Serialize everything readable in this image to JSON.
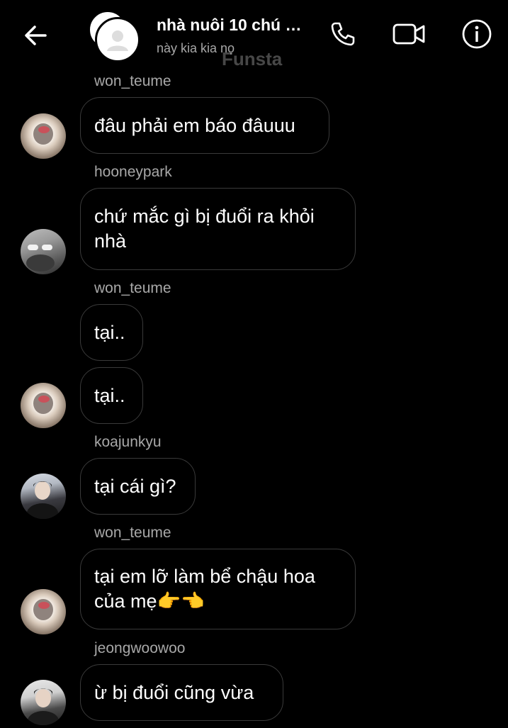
{
  "header": {
    "title": "nhà nuôi 10 chú …",
    "subtitle": "này kia kia nọ",
    "watermark": "Funsta",
    "icons": [
      "back-arrow-icon",
      "phone-icon",
      "video-camera-icon",
      "info-icon"
    ]
  },
  "messages": [
    {
      "sender": "won_teume",
      "lines": [
        "đâu phải em báo đâuuu"
      ],
      "avatar": "cat-photo"
    },
    {
      "sender": "hooneypark",
      "lines": [
        "chứ mắc gì bị đuổi ra khỏi",
        "nhà"
      ],
      "avatar": "hooneypark-photo"
    },
    {
      "sender": "won_teume",
      "lines": [
        "tại.."
      ],
      "avatar": ""
    },
    {
      "sender": "",
      "lines": [
        "tại.."
      ],
      "avatar": "cat-photo"
    },
    {
      "sender": "koajunkyu",
      "lines": [
        "tại cái gì?"
      ],
      "avatar": "koajunkyu-photo"
    },
    {
      "sender": "won_teume",
      "lines": [
        "tại em lỡ làm bể chậu hoa",
        "của mẹ👉👈"
      ],
      "avatar": "cat-photo"
    },
    {
      "sender": "jeongwoowoo",
      "lines": [
        "ừ bị đuổi cũng vừa"
      ],
      "avatar": "jeongwoowoo-photo"
    }
  ],
  "colors": {
    "background": "#000000",
    "bubble_border": "#3a3a3a",
    "sender_text": "#a8a8a8",
    "text": "#ffffff"
  }
}
